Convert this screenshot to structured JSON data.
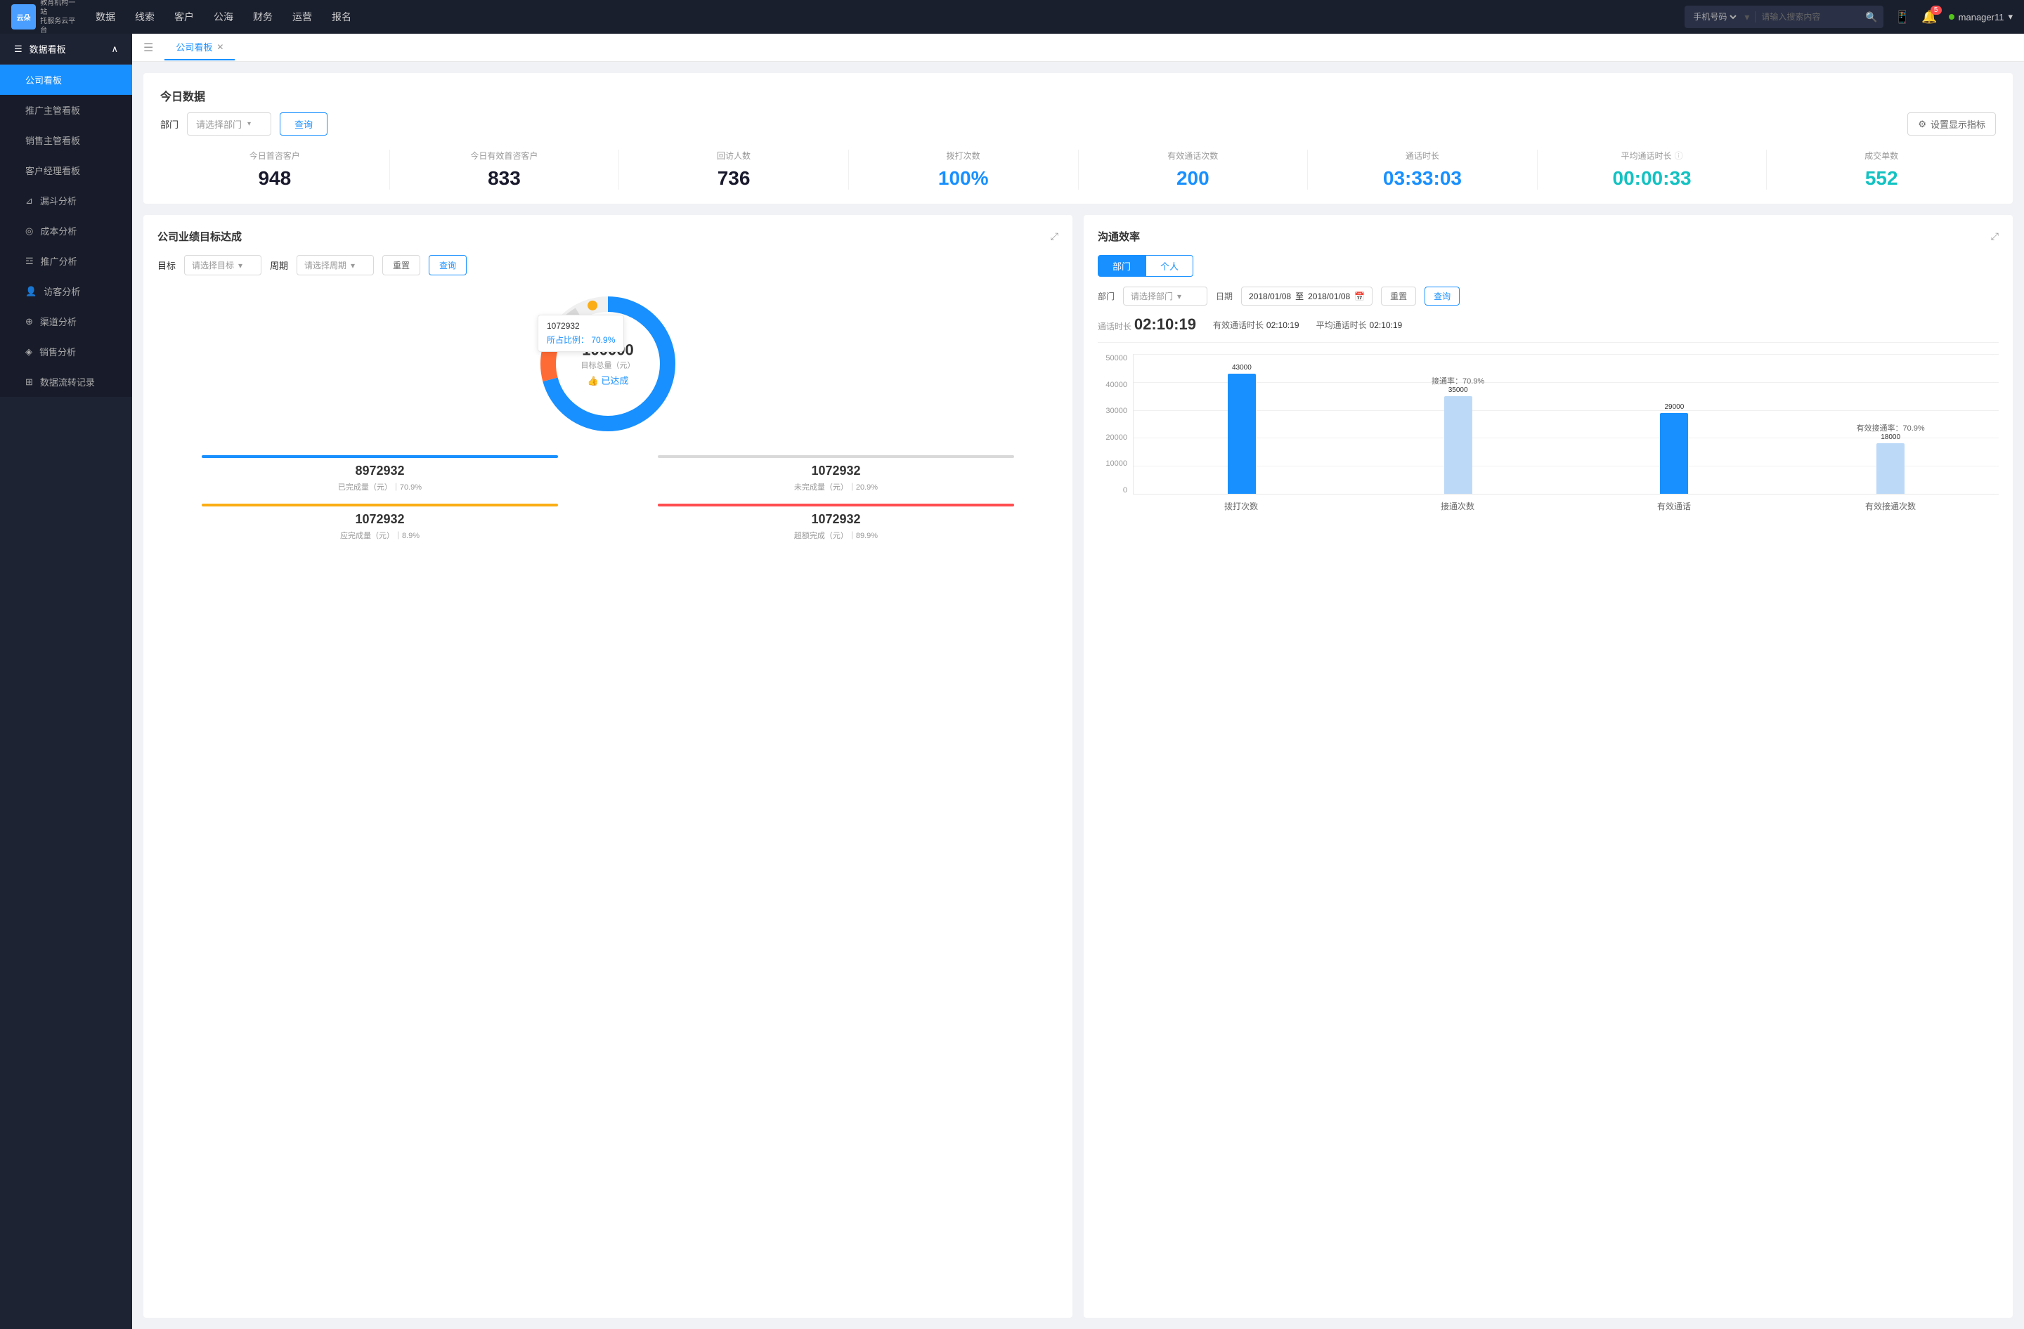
{
  "app": {
    "logo_text": "云朵CRM",
    "logo_sub": "教育机构一站\n托服务云平台"
  },
  "topnav": {
    "items": [
      "数据",
      "线索",
      "客户",
      "公海",
      "财务",
      "运营",
      "报名"
    ],
    "search_placeholder": "请输入搜索内容",
    "search_select": "手机号码",
    "notification_badge": "5",
    "user": "manager11"
  },
  "sidebar": {
    "section_label": "数据看板",
    "items": [
      {
        "label": "公司看板",
        "active": true
      },
      {
        "label": "推广主管看板",
        "active": false
      },
      {
        "label": "销售主管看板",
        "active": false
      },
      {
        "label": "客户经理看板",
        "active": false
      },
      {
        "label": "漏斗分析",
        "active": false
      },
      {
        "label": "成本分析",
        "active": false
      },
      {
        "label": "推广分析",
        "active": false
      },
      {
        "label": "访客分析",
        "active": false
      },
      {
        "label": "渠道分析",
        "active": false
      },
      {
        "label": "销售分析",
        "active": false
      },
      {
        "label": "数据流转记录",
        "active": false
      }
    ]
  },
  "tabs": [
    {
      "label": "公司看板",
      "active": true
    }
  ],
  "today": {
    "section_title": "今日数据",
    "filter_label": "部门",
    "filter_placeholder": "请选择部门",
    "query_btn": "查询",
    "settings_btn": "设置显示指标",
    "metrics": [
      {
        "label": "今日首咨客户",
        "value": "948",
        "color": "dark"
      },
      {
        "label": "今日有效首咨客户",
        "value": "833",
        "color": "dark"
      },
      {
        "label": "回访人数",
        "value": "736",
        "color": "dark"
      },
      {
        "label": "拨打次数",
        "value": "100%",
        "color": "blue"
      },
      {
        "label": "有效通话次数",
        "value": "200",
        "color": "blue"
      },
      {
        "label": "通话时长",
        "value": "03:33:03",
        "color": "blue"
      },
      {
        "label": "平均通话时长",
        "value": "00:00:33",
        "color": "cyan"
      },
      {
        "label": "成交单数",
        "value": "552",
        "color": "cyan"
      }
    ]
  },
  "performance": {
    "title": "公司业绩目标达成",
    "target_label": "目标",
    "target_placeholder": "请选择目标",
    "period_label": "周期",
    "period_placeholder": "请选择周期",
    "reset_btn": "重置",
    "query_btn": "查询",
    "donut": {
      "value": "100000",
      "label": "目标总量（元）",
      "achieved_label": "👍 已达成",
      "tooltip_value": "1072932",
      "tooltip_pct_label": "所占比例：",
      "tooltip_pct": "70.9%",
      "achieved_pct": 70.9,
      "remaining_pct": 20.9
    },
    "stats": [
      {
        "label": "已完成量（元）｜70.9%",
        "value": "8972932",
        "color": "#1890ff"
      },
      {
        "label": "未完成量（元）｜20.9%",
        "value": "1072932",
        "color": "#d9d9d9"
      },
      {
        "label": "应完成量（元）｜8.9%",
        "value": "1072932",
        "color": "#faad14"
      },
      {
        "label": "超额完成（元）｜89.9%",
        "value": "1072932",
        "color": "#ff4d4f"
      }
    ]
  },
  "efficiency": {
    "title": "沟通效率",
    "tabs": [
      "部门",
      "个人"
    ],
    "active_tab": "部门",
    "dept_label": "部门",
    "dept_placeholder": "请选择部门",
    "date_label": "日期",
    "date_start": "2018/01/08",
    "date_end": "2018/01/08",
    "reset_btn": "重置",
    "query_btn": "查询",
    "call_time_label": "通话时长",
    "call_time": "02:10:19",
    "effective_call_label": "有效通话时长",
    "effective_call": "02:10:19",
    "avg_call_label": "平均通话时长",
    "avg_call": "02:10:19",
    "chart": {
      "y_labels": [
        "50000",
        "40000",
        "30000",
        "20000",
        "10000",
        "0"
      ],
      "x_labels": [
        "拨打次数",
        "接通次数",
        "有效通话",
        "有效接通次数"
      ],
      "bars": [
        {
          "main": 43000,
          "sub": null,
          "main_label": "43000",
          "sub_label": null,
          "annotation": null
        },
        {
          "main": 35000,
          "sub": null,
          "main_label": "35000",
          "sub_label": null,
          "annotation": "接通率：70.9%"
        },
        {
          "main": 29000,
          "sub": null,
          "main_label": "29000",
          "sub_label": null,
          "annotation": null
        },
        {
          "main": 18000,
          "sub": null,
          "main_label": "18000",
          "sub_label": null,
          "annotation": "有效接通率：70.9%"
        }
      ],
      "max_value": 50000
    }
  }
}
